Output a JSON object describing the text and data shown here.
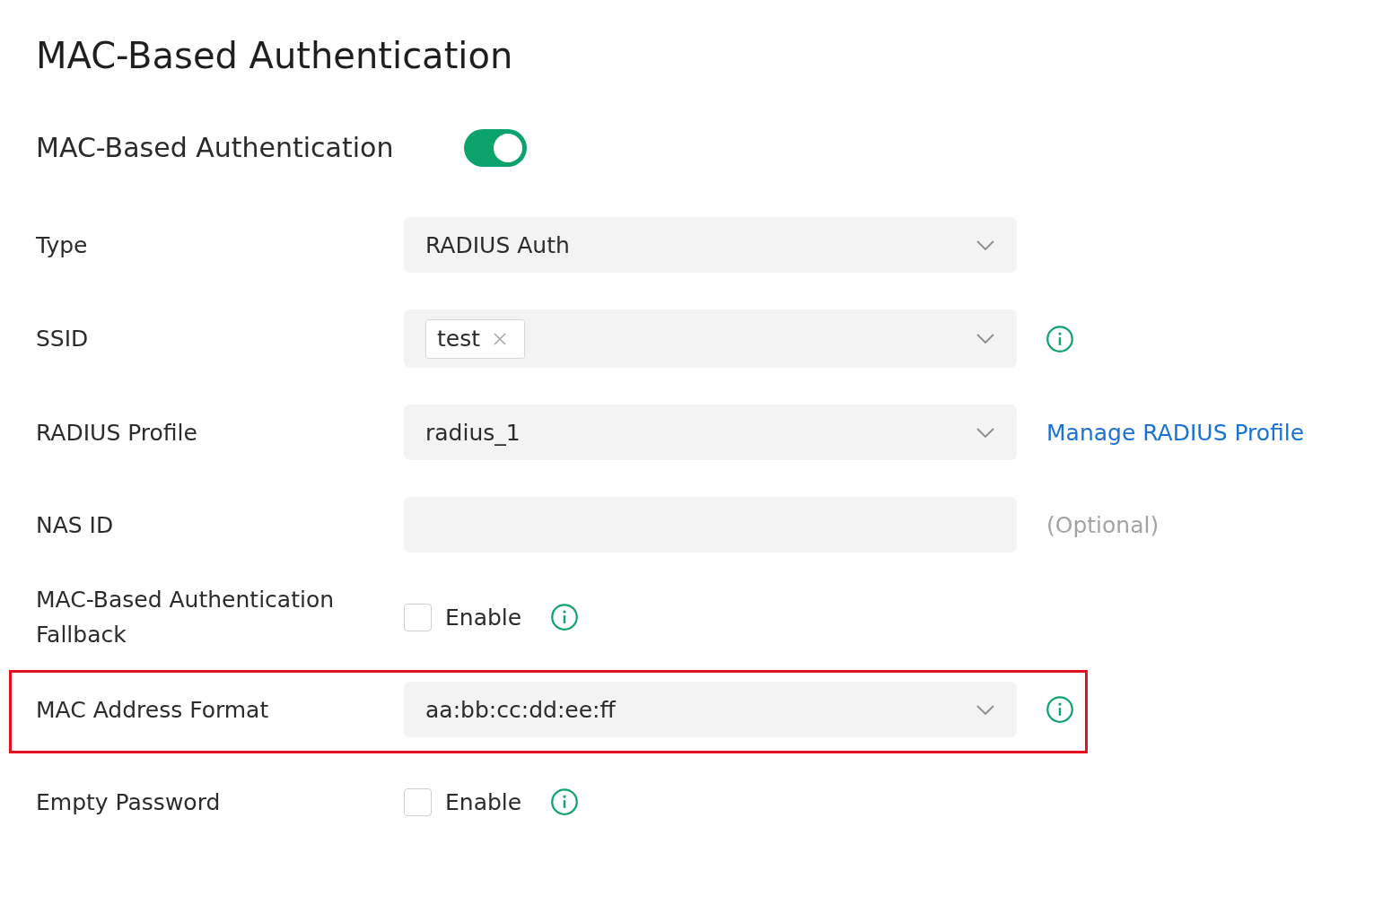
{
  "page_title": "MAC-Based Authentication",
  "toggle_setting": {
    "label": "MAC-Based Authentication",
    "on": true
  },
  "fields": [
    {
      "kind": "select",
      "label": "Type",
      "value": "RADIUS Auth",
      "info": false,
      "highlighted": false
    },
    {
      "kind": "multi_select",
      "label": "SSID",
      "tags": [
        "test"
      ],
      "info": true,
      "highlighted": false
    },
    {
      "kind": "select",
      "label": "RADIUS Profile",
      "value": "radius_1",
      "link": "Manage RADIUS Profile",
      "info": false,
      "highlighted": false
    },
    {
      "kind": "text",
      "label": "NAS ID",
      "note": "(Optional)",
      "info": false,
      "highlighted": false
    },
    {
      "kind": "checkbox",
      "label": "MAC-Based Authentication Fallback",
      "option": "Enable",
      "checked": false,
      "info": true,
      "highlighted": false
    },
    {
      "kind": "select",
      "label": "MAC Address Format",
      "value": "aa:bb:cc:dd:ee:ff",
      "info": true,
      "highlighted": true
    },
    {
      "kind": "checkbox",
      "label": "Empty Password",
      "option": "Enable",
      "checked": false,
      "info": true,
      "highlighted": false
    }
  ]
}
